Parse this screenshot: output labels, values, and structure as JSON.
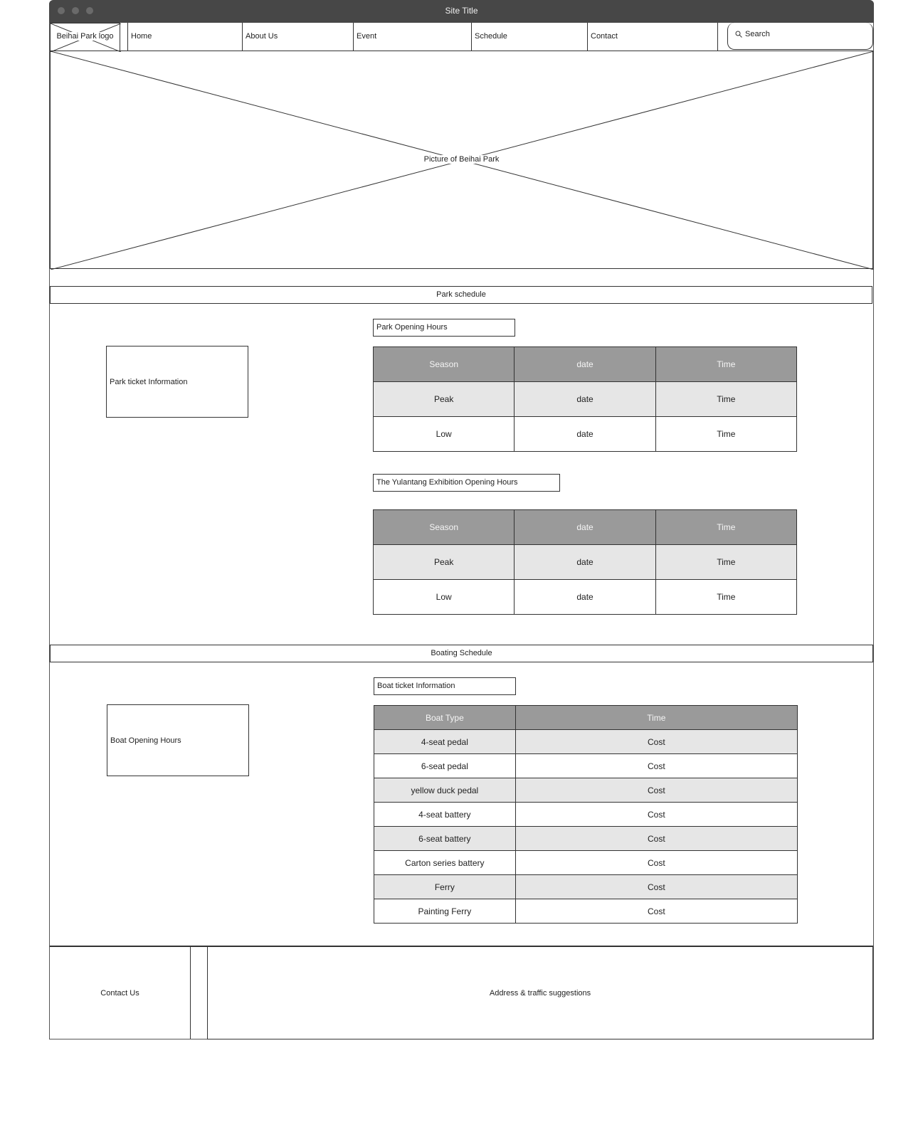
{
  "window": {
    "title": "Site Title"
  },
  "nav": {
    "logo": "Beihai Park logo",
    "items": [
      "Home",
      "About Us",
      "Event",
      "Schedule",
      "Contact"
    ],
    "search_placeholder": "Search"
  },
  "hero": {
    "label": "Picture of Beihai Park"
  },
  "park_schedule": {
    "heading": "Park schedule",
    "ticket_info": "Park ticket Information",
    "opening_hours": {
      "caption": "Park Opening Hours",
      "headers": [
        "Season",
        "date",
        "Time"
      ],
      "rows": [
        [
          "Peak",
          "date",
          "Time"
        ],
        [
          "Low",
          "date",
          "Time"
        ]
      ]
    },
    "exhibition_hours": {
      "caption": "The Yulantang Exhibition Opening Hours",
      "headers": [
        "Season",
        "date",
        "Time"
      ],
      "rows": [
        [
          "Peak",
          "date",
          "Time"
        ],
        [
          "Low",
          "date",
          "Time"
        ]
      ]
    }
  },
  "boating_schedule": {
    "heading": "Boating Schedule",
    "opening_hours": "Boat Opening Hours",
    "ticket_info": {
      "caption": "Boat ticket Information",
      "headers": [
        "Boat Type",
        "Time"
      ],
      "rows": [
        [
          "4-seat pedal",
          "Cost"
        ],
        [
          "6-seat pedal",
          "Cost"
        ],
        [
          "yellow duck pedal",
          "Cost"
        ],
        [
          "4-seat battery",
          "Cost"
        ],
        [
          "6-seat battery",
          "Cost"
        ],
        [
          "Carton series battery",
          "Cost"
        ],
        [
          "Ferry",
          "Cost"
        ],
        [
          "Painting Ferry",
          "Cost"
        ]
      ]
    }
  },
  "footer": {
    "contact": "Contact Us",
    "address": "Address & traffic suggestions"
  }
}
